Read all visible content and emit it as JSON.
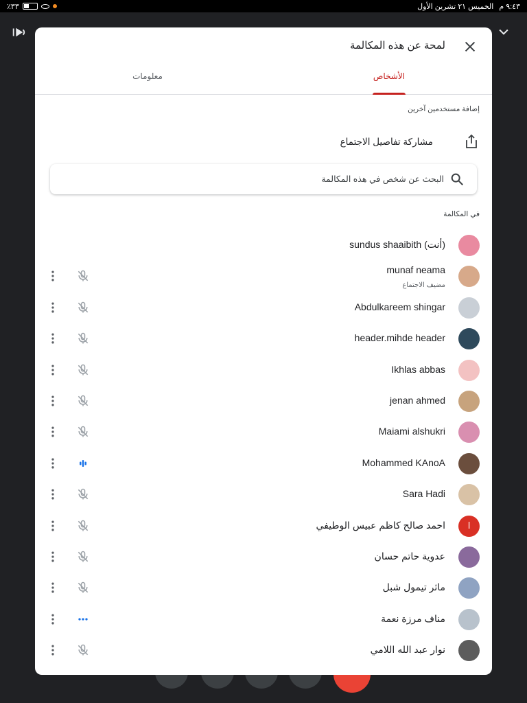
{
  "status_bar": {
    "battery": "٪٣٣",
    "date": "الخميس ٢١ تشرين الأول",
    "time": "٩:٤٣ م"
  },
  "panel": {
    "title": "لمحة عن هذه المكالمة",
    "tabs": [
      {
        "label": "الأشخاص",
        "active": true
      },
      {
        "label": "معلومات",
        "active": false
      }
    ],
    "add_users_label": "إضافة مستخدمين آخرين",
    "share_label": "مشاركة تفاصيل الاجتماع",
    "search": {
      "placeholder": "البحث عن شخص في هذه المكالمة",
      "value": ""
    },
    "in_call_label": "في المكالمة"
  },
  "participants": [
    {
      "name": "sundus shaaibith (أنت)",
      "role": "",
      "avatar_color": "#e98aa0",
      "mic": "none"
    },
    {
      "name": "munaf neama",
      "role": "مضيف الاجتماع",
      "avatar_color": "#d7a98a",
      "mic": "muted"
    },
    {
      "name": "Abdulkareem shingar",
      "role": "",
      "avatar_color": "#c9cfd6",
      "mic": "muted"
    },
    {
      "name": "header.mihde header",
      "role": "",
      "avatar_color": "#2f4a5c",
      "mic": "muted"
    },
    {
      "name": "Ikhlas abbas",
      "role": "",
      "avatar_color": "#f3c2c2",
      "mic": "muted"
    },
    {
      "name": "jenan ahmed",
      "role": "",
      "avatar_color": "#c7a37d",
      "mic": "muted"
    },
    {
      "name": "Maiami alshukri",
      "role": "",
      "avatar_color": "#d98fb0",
      "mic": "muted"
    },
    {
      "name": "Mohammed KAnoA",
      "role": "",
      "avatar_color": "#6b4e3d",
      "mic": "speaking"
    },
    {
      "name": "Sara Hadi",
      "role": "",
      "avatar_color": "#d9c2a6",
      "mic": "muted"
    },
    {
      "name": "احمد صالح كاظم عبيس الوطيفي",
      "role": "",
      "avatar_color": "#d93025",
      "avatar_letter": "ا",
      "mic": "muted"
    },
    {
      "name": "عدوية حاتم حسان",
      "role": "",
      "avatar_color": "#8a6a9c",
      "mic": "muted"
    },
    {
      "name": "ماثر تيمول شبل",
      "role": "",
      "avatar_color": "#8fa3c2",
      "mic": "muted"
    },
    {
      "name": "مناف مرزة نعمة",
      "role": "",
      "avatar_color": "#b8c2cc",
      "mic": "dots"
    },
    {
      "name": "نوار عبد الله اللامي",
      "role": "",
      "avatar_color": "#5c5c5c",
      "mic": "muted"
    }
  ],
  "colors": {
    "accent": "#c5221f",
    "speaking": "#1a73e8",
    "muted_icon": "#9aa0a6"
  }
}
